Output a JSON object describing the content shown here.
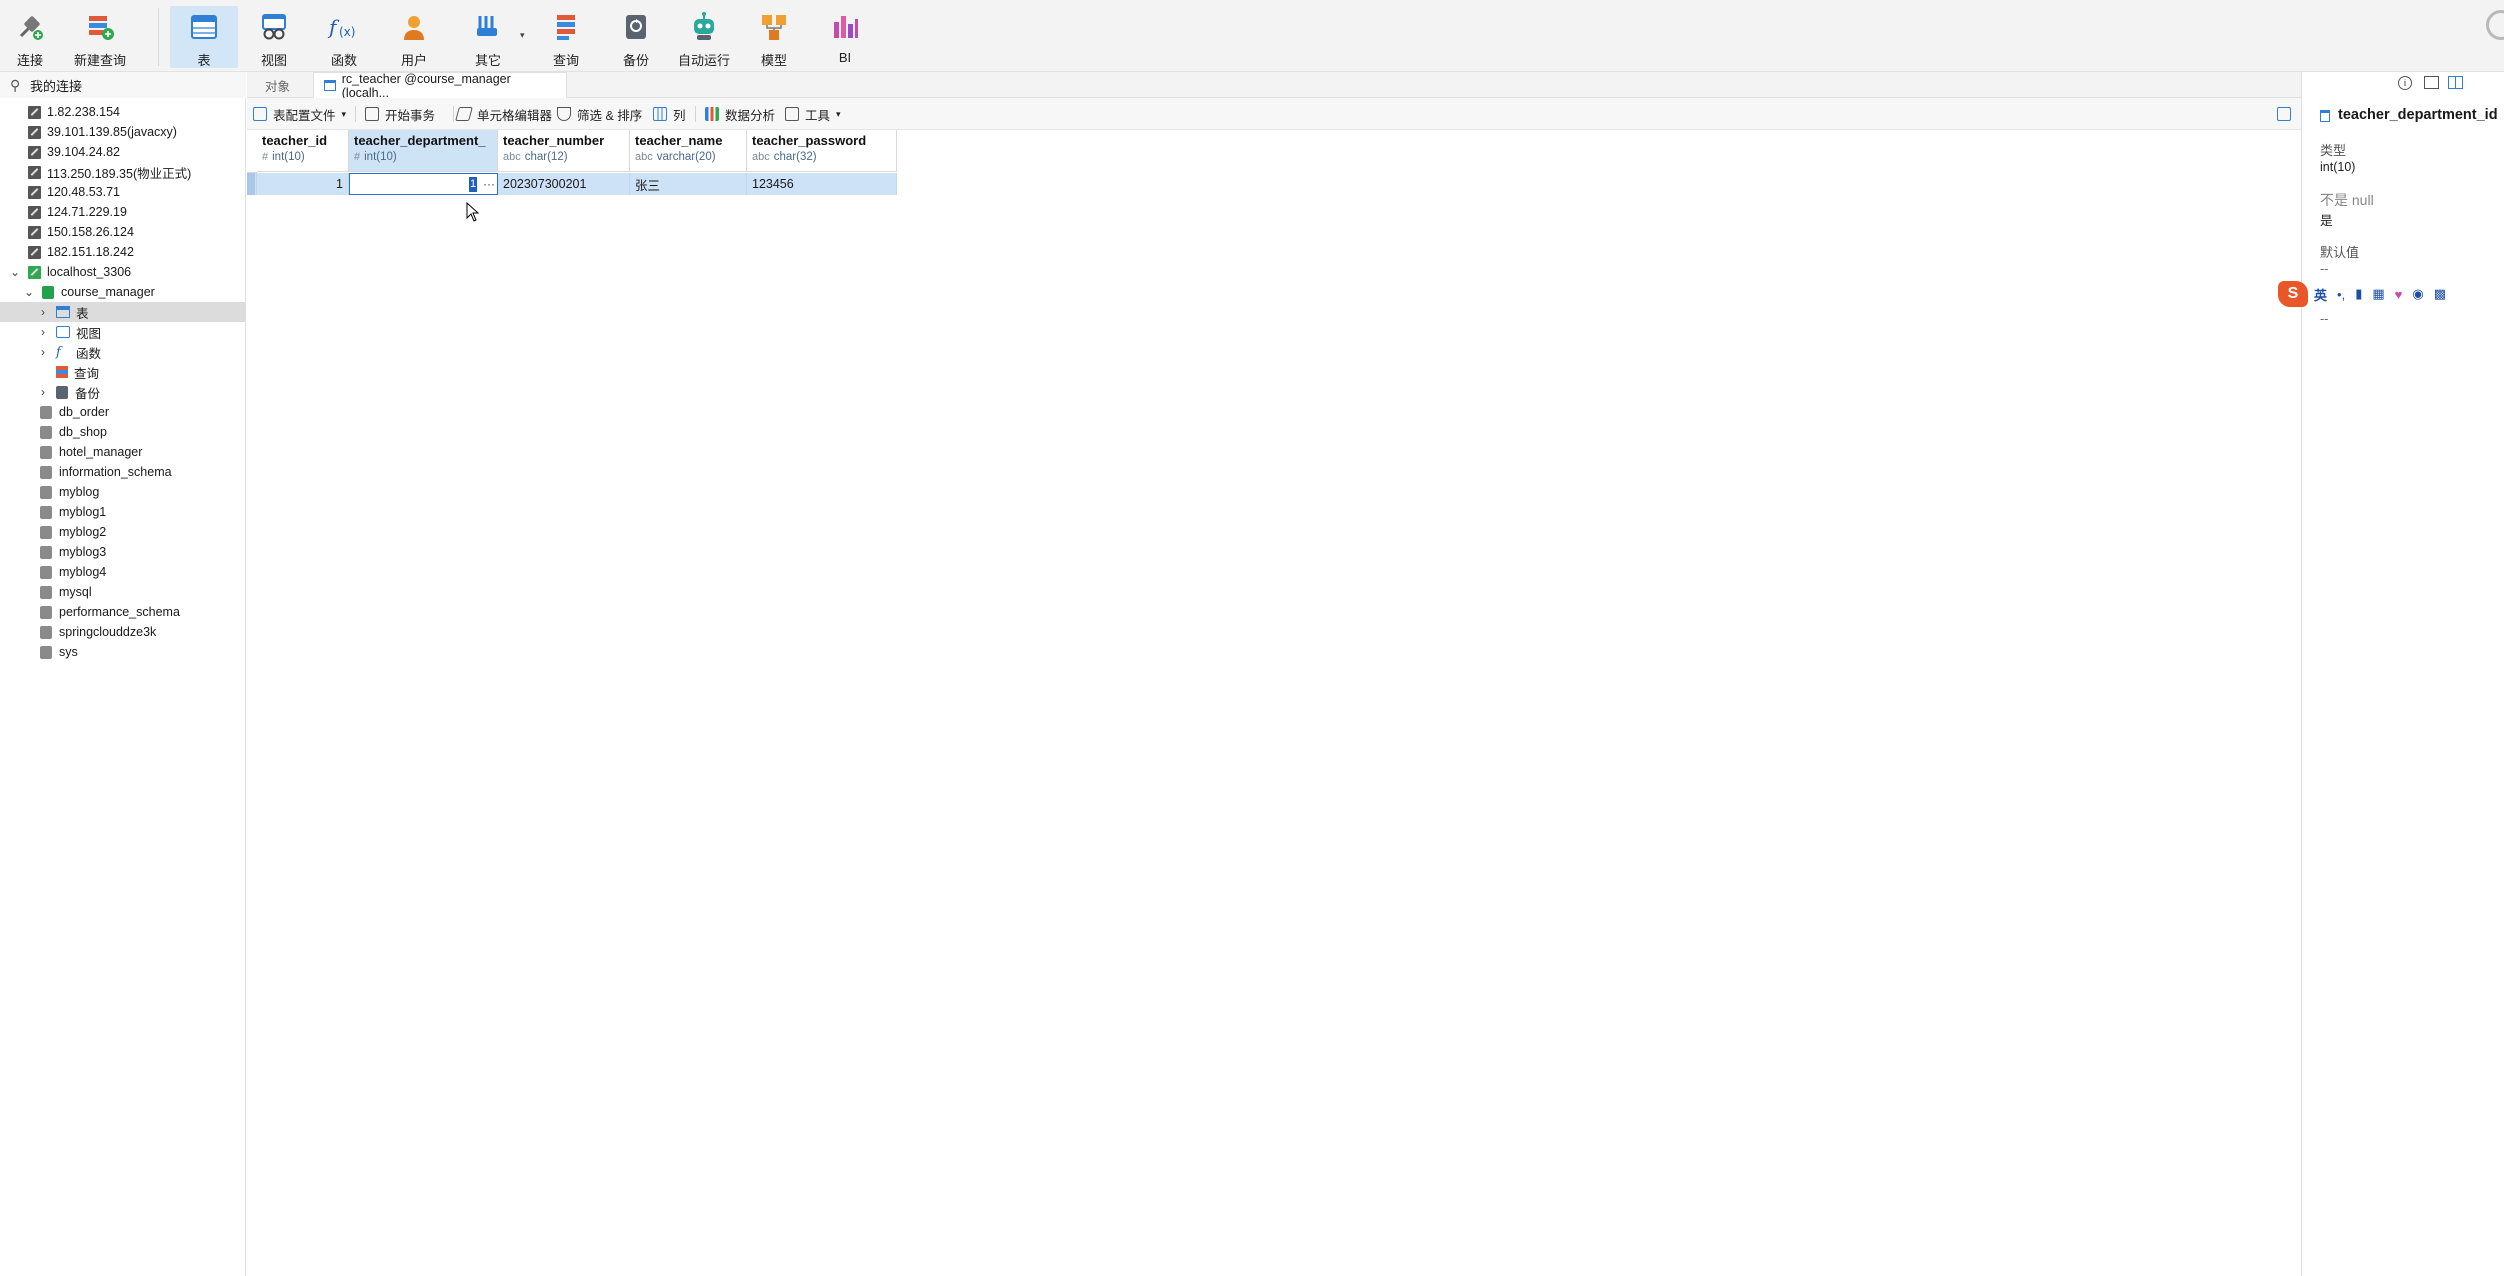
{
  "toolbar": {
    "buttons": [
      {
        "id": "connect",
        "label": "连接",
        "icon": "plug-icon"
      },
      {
        "id": "new_query",
        "label": "新建查询",
        "icon": "new-query-icon"
      },
      {
        "id": "table",
        "label": "表",
        "icon": "table-icon",
        "active": true
      },
      {
        "id": "view",
        "label": "视图",
        "icon": "view-icon"
      },
      {
        "id": "function",
        "label": "函数",
        "icon": "function-icon"
      },
      {
        "id": "user",
        "label": "用户",
        "icon": "user-icon"
      },
      {
        "id": "other",
        "label": "其它",
        "icon": "tools-icon"
      },
      {
        "id": "query",
        "label": "查询",
        "icon": "query-icon"
      },
      {
        "id": "backup",
        "label": "备份",
        "icon": "backup-icon"
      },
      {
        "id": "automation",
        "label": "自动运行",
        "icon": "robot-icon"
      },
      {
        "id": "model",
        "label": "模型",
        "icon": "model-icon"
      },
      {
        "id": "bi",
        "label": "BI",
        "icon": "bi-icon"
      }
    ]
  },
  "sidebar": {
    "header": "我的连接",
    "connections": [
      "1.82.238.154",
      "39.101.139.85(javacxy)",
      "39.104.24.82",
      "113.250.189.35(物业正式)",
      "120.48.53.71",
      "124.71.229.19",
      "150.158.26.124",
      "182.151.18.242"
    ],
    "local": "localhost_3306",
    "open_db": "course_manager",
    "db_children": [
      "表",
      "视图",
      "函数",
      "查询",
      "备份"
    ],
    "other_dbs": [
      "db_order",
      "db_shop",
      "hotel_manager",
      "information_schema",
      "myblog",
      "myblog1",
      "myblog2",
      "myblog3",
      "myblog4",
      "mysql",
      "performance_schema",
      "springclouddze3k",
      "sys"
    ]
  },
  "tabs": {
    "objects": "对象",
    "active": "rc_teacher @course_manager (localh..."
  },
  "editor_toolbar": {
    "table_config": "表配置文件",
    "begin_tx": "开始事务",
    "cell_editor": "单元格编辑器",
    "filter_sort": "筛选 & 排序",
    "columns": "列",
    "data_analysis": "数据分析",
    "tools": "工具"
  },
  "grid": {
    "columns": [
      {
        "name": "teacher_id",
        "type": "int(10)",
        "sym": "#"
      },
      {
        "name": "teacher_department_",
        "type": "int(10)",
        "sym": "#"
      },
      {
        "name": "teacher_number",
        "type": "char(12)",
        "sym": "a͏b͏c"
      },
      {
        "name": "teacher_name",
        "type": "varchar(20)",
        "sym": "a͏b͏c"
      },
      {
        "name": "teacher_password",
        "type": "char(32)",
        "sym": "a͏b͏c"
      }
    ],
    "row": {
      "teacher_id": "1",
      "teacher_department_": "1",
      "teacher_number": "202307300201",
      "teacher_name": "张三",
      "teacher_password": "123456"
    }
  },
  "right_panel": {
    "field_name": "teacher_department_id",
    "type_label": "类型",
    "type_value": "int(10)",
    "notnull_label": "不是 null",
    "notnull_value": "是",
    "default_label": "默认值",
    "default_value": "--",
    "comment_value": "--"
  },
  "ime": {
    "logo": "S",
    "lang": "英"
  },
  "colors": {
    "accent": "#2a6fcf",
    "selection": "#cde1f7",
    "toolbar_active": "#d3e6f8"
  }
}
